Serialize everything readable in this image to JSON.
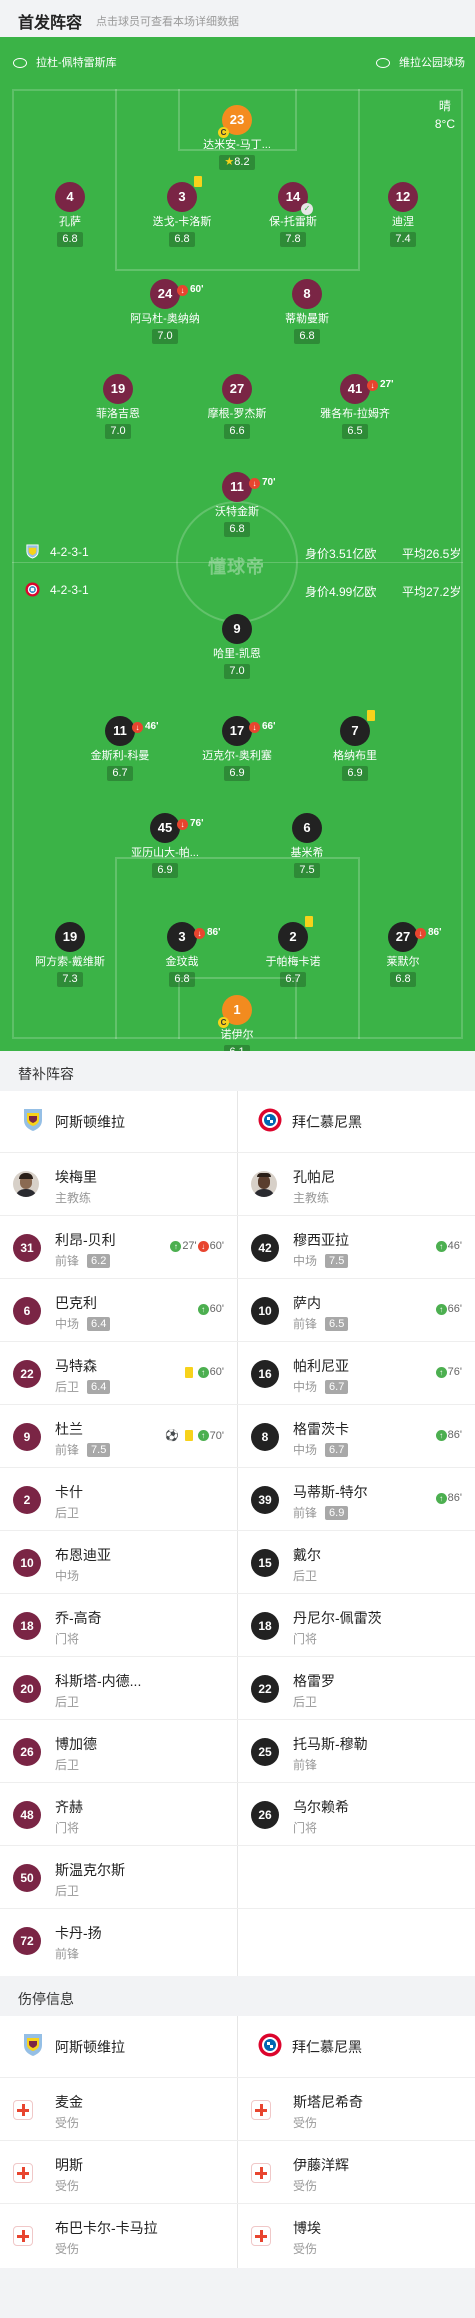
{
  "header": {
    "title": "首发阵容",
    "subtitle": "点击球员可查看本场详细数据"
  },
  "pitch": {
    "home_stadium": "拉杜-佩特雷斯库",
    "away_stadium": "维拉公园球场",
    "weather": "晴",
    "temperature": "8°C",
    "watermark": "懂球帝"
  },
  "formations": {
    "top": {
      "formation": "4-2-3-1",
      "value": "身价3.51亿欧",
      "age": "平均26.5岁"
    },
    "bottom": {
      "formation": "4-2-3-1",
      "value": "身价4.99亿欧",
      "age": "平均27.2岁"
    }
  },
  "pitch_players": [
    {
      "num": "23",
      "name": "达米安-马丁...",
      "rating": "8.2",
      "star": true,
      "team": "gky",
      "captain": true
    },
    {
      "num": "4",
      "name": "孔萨",
      "rating": "6.8",
      "team": "av"
    },
    {
      "num": "3",
      "name": "迭戈-卡洛斯",
      "rating": "6.8",
      "team": "av",
      "card": true
    },
    {
      "num": "14",
      "name": "保-托雷斯",
      "rating": "7.8",
      "team": "av",
      "check": true
    },
    {
      "num": "12",
      "name": "迪涅",
      "rating": "7.4",
      "team": "av"
    },
    {
      "num": "24",
      "name": "阿马杜-奥纳纳",
      "rating": "7.0",
      "team": "av",
      "sub": "60'"
    },
    {
      "num": "8",
      "name": "蒂勒曼斯",
      "rating": "6.8",
      "team": "av"
    },
    {
      "num": "19",
      "name": "菲洛吉恩",
      "rating": "7.0",
      "team": "av"
    },
    {
      "num": "27",
      "name": "摩根-罗杰斯",
      "rating": "6.6",
      "team": "av"
    },
    {
      "num": "41",
      "name": "雅各布-拉姆齐",
      "rating": "6.5",
      "team": "av",
      "sub": "27'"
    },
    {
      "num": "11",
      "name": "沃特金斯",
      "rating": "6.8",
      "team": "av",
      "sub": "70'"
    },
    {
      "num": "9",
      "name": "哈里-凯恩",
      "rating": "7.0",
      "team": "fc"
    },
    {
      "num": "11",
      "name": "金斯利-科曼",
      "rating": "6.7",
      "team": "fc",
      "sub": "46'"
    },
    {
      "num": "17",
      "name": "迈克尔-奥利塞",
      "rating": "6.9",
      "team": "fc",
      "sub": "66'"
    },
    {
      "num": "7",
      "name": "格纳布里",
      "rating": "6.9",
      "team": "fc",
      "card": true
    },
    {
      "num": "45",
      "name": "亚历山大-帕...",
      "rating": "6.9",
      "team": "fc",
      "sub": "76'"
    },
    {
      "num": "6",
      "name": "基米希",
      "rating": "7.5",
      "team": "fc"
    },
    {
      "num": "19",
      "name": "阿方索-戴维斯",
      "rating": "7.3",
      "team": "fc"
    },
    {
      "num": "3",
      "name": "金玟哉",
      "rating": "6.8",
      "team": "fc",
      "sub": "86'"
    },
    {
      "num": "2",
      "name": "于帕梅卡诺",
      "rating": "6.7",
      "team": "fc",
      "card": true
    },
    {
      "num": "27",
      "name": "莱默尔",
      "rating": "6.8",
      "team": "fc",
      "sub": "86'"
    },
    {
      "num": "1",
      "name": "诺伊尔",
      "rating": "6.1",
      "team": "gk",
      "captain": true
    }
  ],
  "subs": {
    "title": "替补阵容",
    "home_team": "阿斯顿维拉",
    "away_team": "拜仁慕尼黑",
    "home_coach": {
      "name": "埃梅里",
      "role": "主教练"
    },
    "away_coach": {
      "name": "孔帕尼",
      "role": "主教练"
    },
    "home": [
      {
        "num": "31",
        "name": "利昂-贝利",
        "pos": "前锋",
        "rating": "6.2",
        "in": "27'",
        "out": "60'"
      },
      {
        "num": "6",
        "name": "巴克利",
        "pos": "中场",
        "rating": "6.4",
        "in": "60'"
      },
      {
        "num": "22",
        "name": "马特森",
        "pos": "后卫",
        "rating": "6.4",
        "yellow": true,
        "in": "60'"
      },
      {
        "num": "9",
        "name": "杜兰",
        "pos": "前锋",
        "rating": "7.5",
        "goal": true,
        "yellow": true,
        "in": "70'"
      },
      {
        "num": "2",
        "name": "卡什",
        "pos": "后卫"
      },
      {
        "num": "10",
        "name": "布恩迪亚",
        "pos": "中场"
      },
      {
        "num": "18",
        "name": "乔-高奇",
        "pos": "门将"
      },
      {
        "num": "20",
        "name": "科斯塔-内德...",
        "pos": "后卫"
      },
      {
        "num": "26",
        "name": "博加德",
        "pos": "后卫"
      },
      {
        "num": "48",
        "name": "齐赫",
        "pos": "门将"
      },
      {
        "num": "50",
        "name": "斯温克尔斯",
        "pos": "后卫"
      },
      {
        "num": "72",
        "name": "卡丹-扬",
        "pos": "前锋"
      }
    ],
    "away": [
      {
        "num": "42",
        "name": "穆西亚拉",
        "pos": "中场",
        "rating": "7.5",
        "in": "46'"
      },
      {
        "num": "10",
        "name": "萨内",
        "pos": "前锋",
        "rating": "6.5",
        "in": "66'"
      },
      {
        "num": "16",
        "name": "帕利尼亚",
        "pos": "中场",
        "rating": "6.7",
        "in": "76'"
      },
      {
        "num": "8",
        "name": "格雷茨卡",
        "pos": "中场",
        "rating": "6.7",
        "in": "86'"
      },
      {
        "num": "39",
        "name": "马蒂斯-特尔",
        "pos": "前锋",
        "rating": "6.9",
        "in": "86'"
      },
      {
        "num": "15",
        "name": "戴尔",
        "pos": "后卫"
      },
      {
        "num": "18",
        "name": "丹尼尔-佩雷茨",
        "pos": "门将"
      },
      {
        "num": "22",
        "name": "格雷罗",
        "pos": "后卫"
      },
      {
        "num": "25",
        "name": "托马斯-穆勒",
        "pos": "前锋"
      },
      {
        "num": "26",
        "name": "乌尔赖希",
        "pos": "门将"
      }
    ]
  },
  "injuries": {
    "title": "伤停信息",
    "home_team": "阿斯顿维拉",
    "away_team": "拜仁慕尼黑",
    "home": [
      {
        "name": "麦金",
        "status": "受伤"
      },
      {
        "name": "明斯",
        "status": "受伤"
      },
      {
        "name": "布巴卡尔-卡马拉",
        "status": "受伤"
      }
    ],
    "away": [
      {
        "name": "斯塔尼希奇",
        "status": "受伤"
      },
      {
        "name": "伊藤洋辉",
        "status": "受伤"
      },
      {
        "name": "博埃",
        "status": "受伤"
      }
    ]
  }
}
